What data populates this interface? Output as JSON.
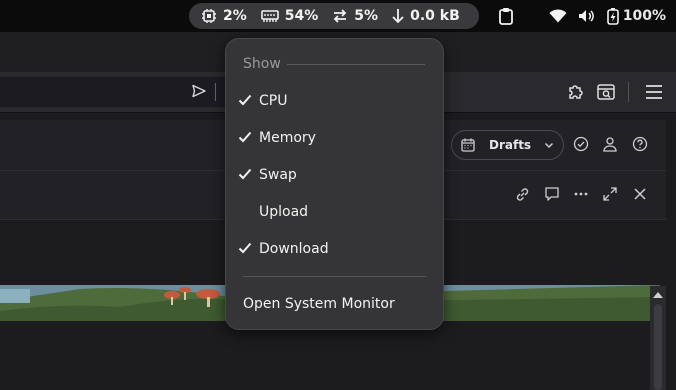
{
  "topbar": {
    "cpu": "2%",
    "memory": "54%",
    "swap": "5%",
    "download": "0.0 kB",
    "battery": "100%"
  },
  "browser": {
    "drafts_label": "Drafts"
  },
  "menu": {
    "header": "Show",
    "items": [
      {
        "label": "CPU",
        "checked": true
      },
      {
        "label": "Memory",
        "checked": true
      },
      {
        "label": "Swap",
        "checked": true
      },
      {
        "label": "Upload",
        "checked": false
      },
      {
        "label": "Download",
        "checked": true
      }
    ],
    "open_monitor": "Open System Monitor"
  }
}
